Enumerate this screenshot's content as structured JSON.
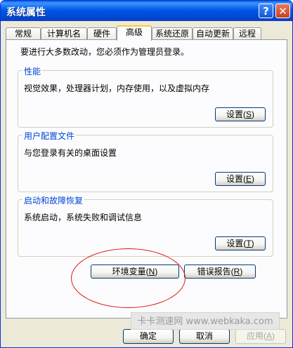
{
  "window": {
    "title": "系统属性",
    "help_glyph": "?",
    "close_glyph": "✕"
  },
  "tabs": [
    {
      "label": "常规"
    },
    {
      "label": "计算机名"
    },
    {
      "label": "硬件"
    },
    {
      "label": "高级",
      "active": true
    },
    {
      "label": "系统还原"
    },
    {
      "label": "自动更新"
    },
    {
      "label": "远程"
    }
  ],
  "admin_note": "要进行大多数改动，您必须作为管理员登录。",
  "groups": [
    {
      "title": "性能",
      "desc": "视觉效果，处理器计划，内存使用，以及虚拟内存",
      "button": "设置",
      "key": "S"
    },
    {
      "title": "用户配置文件",
      "desc": "与您登录有关的桌面设置",
      "button": "设置",
      "key": "E"
    },
    {
      "title": "启动和故障恢复",
      "desc": "系统启动，系统失败和调试信息",
      "button": "设置",
      "key": "T"
    }
  ],
  "env_button": {
    "label": "环境变量",
    "key": "N"
  },
  "error_button": {
    "label": "错误报告",
    "key": "R"
  },
  "watermark": "卡卡测速网 www.webkaka.com",
  "footer": {
    "ok": "确定",
    "cancel": "取消",
    "apply": "应用",
    "apply_key": "A"
  },
  "colors": {
    "titlebar": "#0058e6",
    "group_title": "#0046d5",
    "highlight_ellipse": "#e01010",
    "active_tab_accent": "#ffc73c"
  }
}
